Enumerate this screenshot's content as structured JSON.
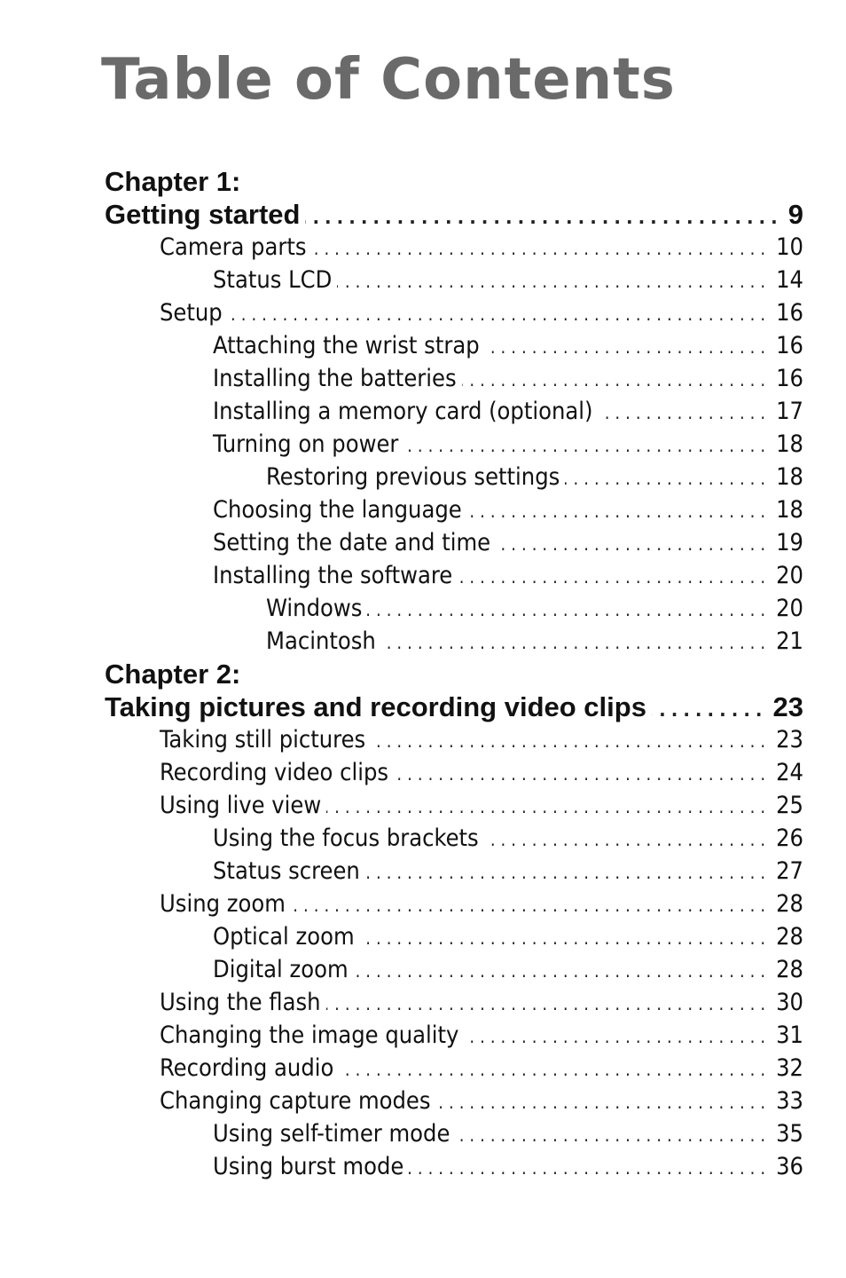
{
  "title": "Table of Contents",
  "chapters": [
    {
      "label": "Chapter 1:",
      "title": "Getting started",
      "page": "9",
      "entries": [
        {
          "level": 1,
          "text": "Camera parts",
          "page": "10"
        },
        {
          "level": 2,
          "text": "Status LCD",
          "page": "14"
        },
        {
          "level": 1,
          "text": "Setup",
          "page": "16"
        },
        {
          "level": 2,
          "text": "Attaching the wrist strap",
          "page": "16"
        },
        {
          "level": 2,
          "text": "Installing the batteries",
          "page": "16"
        },
        {
          "level": 2,
          "text": "Installing a memory card (optional)",
          "page": "17"
        },
        {
          "level": 2,
          "text": "Turning on power",
          "page": "18"
        },
        {
          "level": 3,
          "text": "Restoring previous settings",
          "page": "18"
        },
        {
          "level": 2,
          "text": "Choosing the language",
          "page": "18"
        },
        {
          "level": 2,
          "text": "Setting the date and time",
          "page": "19"
        },
        {
          "level": 2,
          "text": "Installing the software",
          "page": "20"
        },
        {
          "level": 3,
          "text": "Windows",
          "page": "20"
        },
        {
          "level": 3,
          "text": "Macintosh",
          "page": "21"
        }
      ]
    },
    {
      "label": "Chapter 2:",
      "title": "Taking pictures and recording video clips",
      "page": "23",
      "entries": [
        {
          "level": 1,
          "text": "Taking still pictures",
          "page": "23"
        },
        {
          "level": 1,
          "text": "Recording video clips",
          "page": "24"
        },
        {
          "level": 1,
          "text": "Using live view",
          "page": "25"
        },
        {
          "level": 2,
          "text": "Using the focus brackets",
          "page": "26"
        },
        {
          "level": 2,
          "text": "Status screen",
          "page": "27"
        },
        {
          "level": 1,
          "text": "Using zoom",
          "page": "28"
        },
        {
          "level": 2,
          "text": "Optical zoom",
          "page": "28"
        },
        {
          "level": 2,
          "text": "Digital zoom",
          "page": "28"
        },
        {
          "level": 1,
          "text": "Using the flash",
          "page": "30"
        },
        {
          "level": 1,
          "text": "Changing the image quality",
          "page": "31"
        },
        {
          "level": 1,
          "text": "Recording audio",
          "page": "32"
        },
        {
          "level": 1,
          "text": "Changing capture modes",
          "page": "33"
        },
        {
          "level": 2,
          "text": "Using self-timer mode",
          "page": "35"
        },
        {
          "level": 2,
          "text": "Using burst mode",
          "page": "36"
        }
      ]
    }
  ]
}
